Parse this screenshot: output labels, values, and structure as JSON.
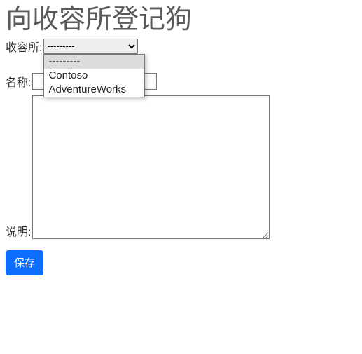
{
  "page": {
    "title": "向收容所登记狗"
  },
  "labels": {
    "shelter": "收容所:",
    "name": "名称:",
    "description": "说明:"
  },
  "form": {
    "shelter_selected": "---------",
    "shelter_options": [
      {
        "label": "---------"
      },
      {
        "label": "Contoso"
      },
      {
        "label": "AdventureWorks"
      }
    ],
    "name_value": "",
    "description_value": "",
    "save_label": "保存"
  }
}
